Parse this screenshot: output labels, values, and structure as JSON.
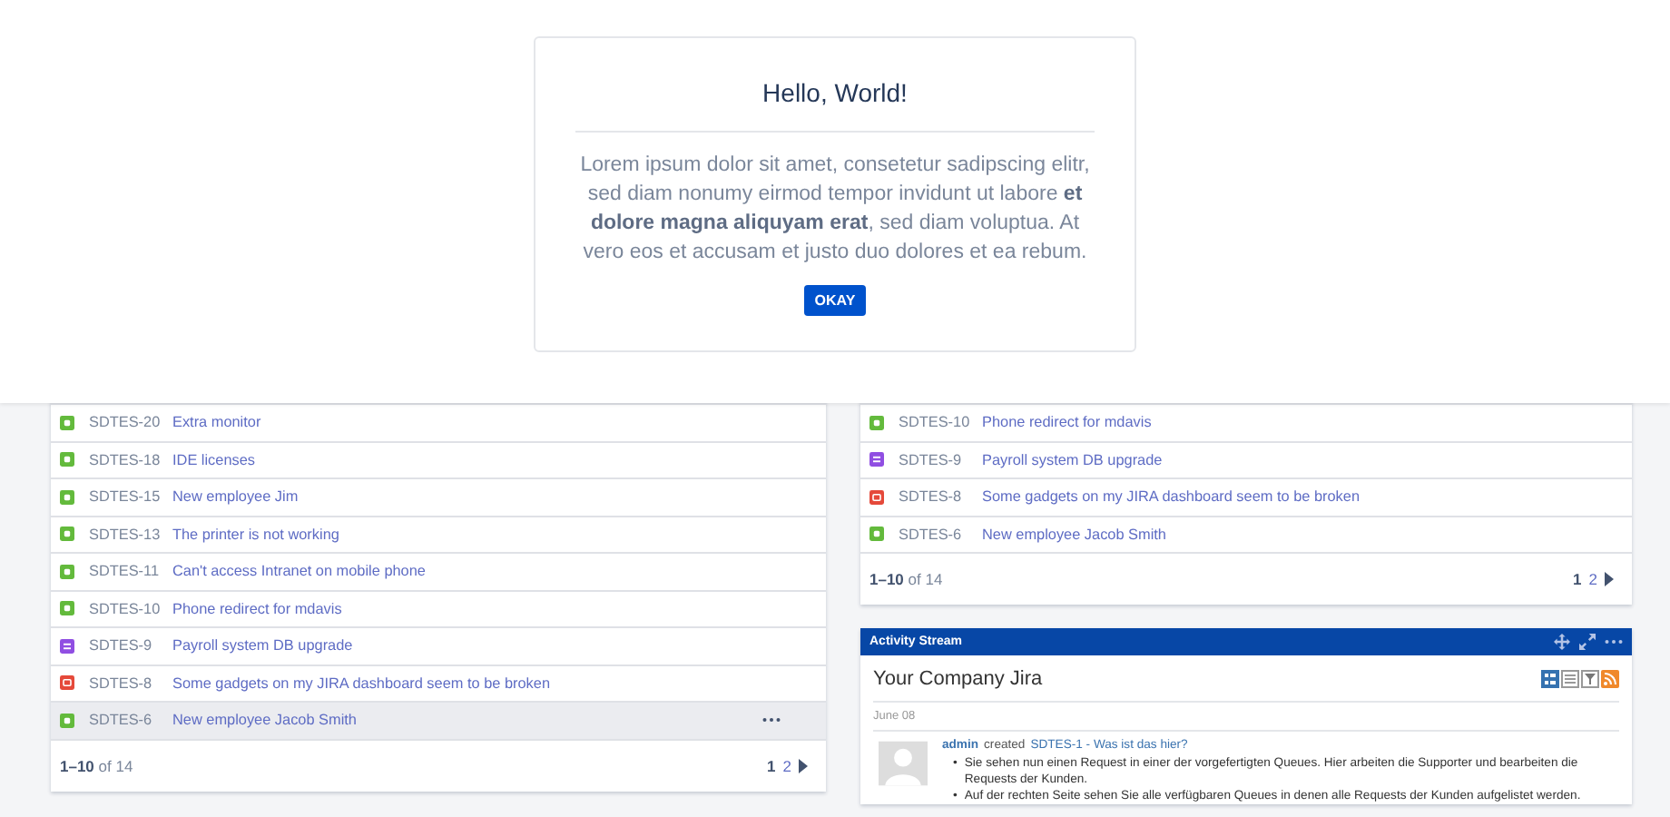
{
  "dialog": {
    "title": "Hello, World!",
    "body": "Lorem ipsum dolor sit amet, consetetur sadipscing elitr, sed diam nonumy eirmod tempor invidunt ut labore **et dolore magna aliquyam erat**, sed diam voluptua. At vero eos et accusam et justo duo dolores et ea rebum.",
    "button": "OKAY"
  },
  "left_queue": {
    "rows": [
      {
        "key": "SDTES-20",
        "summary": "Extra monitor",
        "kind": "story",
        "selected": false
      },
      {
        "key": "SDTES-18",
        "summary": "IDE licenses",
        "kind": "story",
        "selected": false
      },
      {
        "key": "SDTES-15",
        "summary": "New employee Jim",
        "kind": "story",
        "selected": false
      },
      {
        "key": "SDTES-13",
        "summary": "The printer is not working",
        "kind": "story",
        "selected": false
      },
      {
        "key": "SDTES-11",
        "summary": "Can't access Intranet on mobile phone",
        "kind": "story",
        "selected": false
      },
      {
        "key": "SDTES-10",
        "summary": "Phone redirect for mdavis",
        "kind": "story",
        "selected": false
      },
      {
        "key": "SDTES-9",
        "summary": "Payroll system DB upgrade",
        "kind": "task",
        "selected": false
      },
      {
        "key": "SDTES-8",
        "summary": "Some gadgets on my JIRA dashboard seem to be broken",
        "kind": "bug",
        "selected": false
      },
      {
        "key": "SDTES-6",
        "summary": "New employee Jacob Smith",
        "kind": "story",
        "selected": true
      }
    ],
    "range": "1–10",
    "of": "of 14",
    "pages": [
      {
        "label": "1",
        "selected": true
      },
      {
        "label": "2",
        "selected": false
      }
    ]
  },
  "right_queue": {
    "rows": [
      {
        "key": "SDTES-10",
        "summary": "Phone redirect for mdavis",
        "kind": "story",
        "selected": false
      },
      {
        "key": "SDTES-9",
        "summary": "Payroll system DB upgrade",
        "kind": "task",
        "selected": false
      },
      {
        "key": "SDTES-8",
        "summary": "Some gadgets on my JIRA dashboard seem to be broken",
        "kind": "bug",
        "selected": false
      },
      {
        "key": "SDTES-6",
        "summary": "New employee Jacob Smith",
        "kind": "story",
        "selected": false
      }
    ],
    "range": "1–10",
    "of": "of 14",
    "pages": [
      {
        "label": "1",
        "selected": true
      },
      {
        "label": "2",
        "selected": false
      }
    ]
  },
  "activity_stream": {
    "title": "Activity Stream",
    "site": "Your Company Jira",
    "date": "June 08",
    "entry": {
      "user": "admin",
      "action": "created",
      "link": "SDTES-1 - Was ist das hier?",
      "bullets": [
        {
          "marker": "•",
          "text": "Sie sehen nun einen Request in einer der vorgefertigten Queues. Hier arbeiten die Supporter und bearbeiten die Requests der Kunden."
        },
        {
          "marker": "•",
          "text": "Auf der rechten Seite sehen Sie alle verfügbaren Queues in denen alle Requests der Kunden aufgelistet werden."
        }
      ]
    }
  }
}
